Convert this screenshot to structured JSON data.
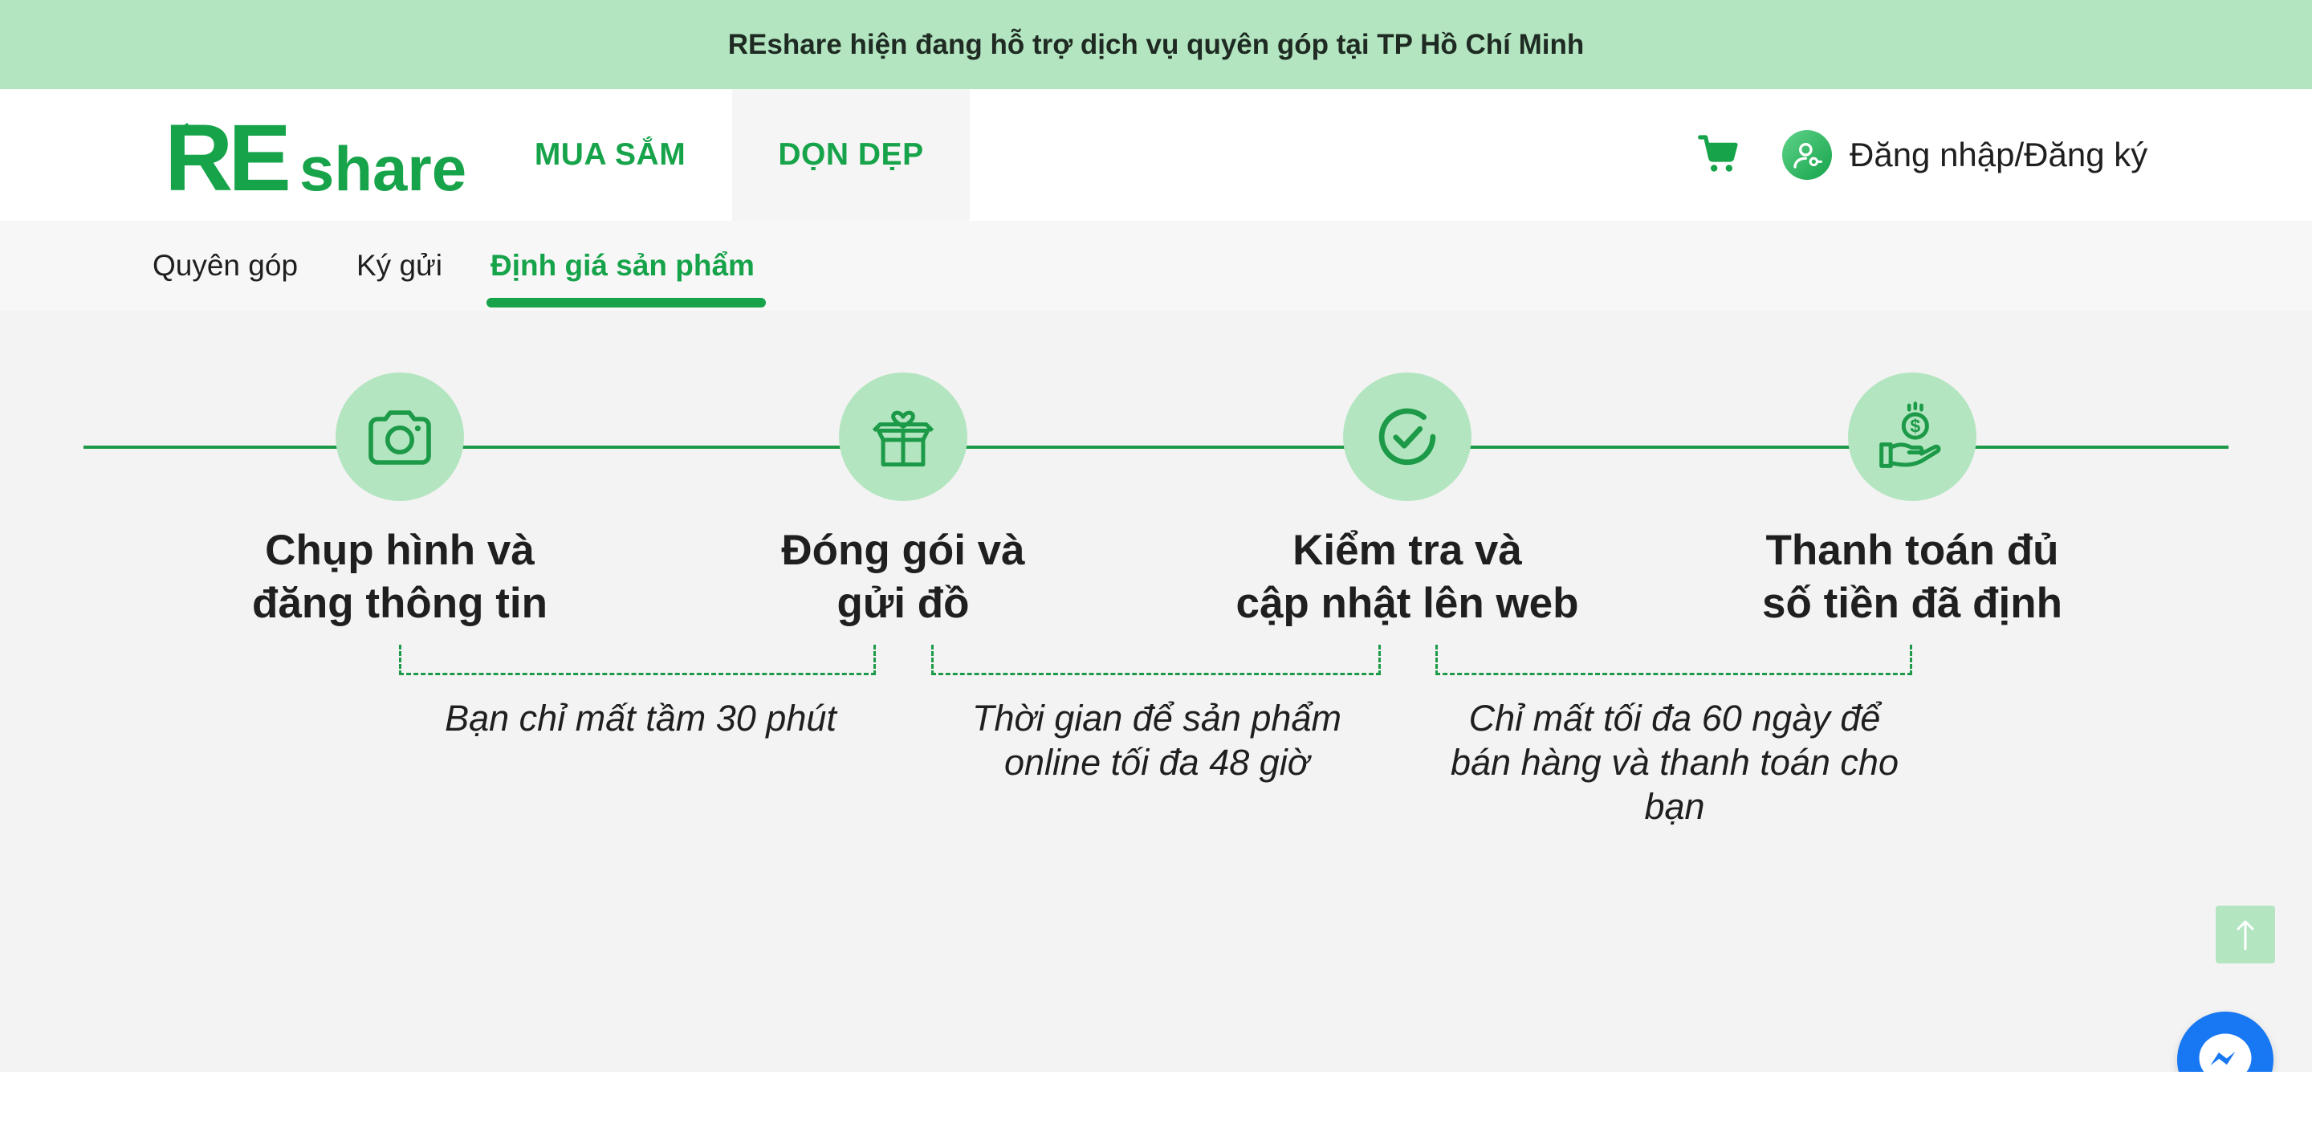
{
  "banner": {
    "text": "REshare hiện đang hỗ trợ dịch vụ quyên góp tại TP Hồ Chí Minh"
  },
  "header": {
    "logo": {
      "text_re": "RE",
      "text_share": "share"
    },
    "nav": [
      {
        "label": "MUA SẮM"
      },
      {
        "label": "DỌN DẸP"
      }
    ],
    "cart_icon": "cart-icon",
    "login_label": "Đăng nhập/Đăng ký"
  },
  "subnav": {
    "items": [
      {
        "label": "Quyên góp"
      },
      {
        "label": "Ký gửi"
      },
      {
        "label": "Định giá sản phẩm",
        "active": true
      }
    ]
  },
  "steps": [
    {
      "icon": "camera-icon",
      "title": "Chụp hình và\nđăng thông tin"
    },
    {
      "icon": "gift-box-icon",
      "title": "Đóng gói và\ngửi đồ"
    },
    {
      "icon": "check-circle-icon",
      "title": "Kiểm tra và\ncập nhật lên web"
    },
    {
      "icon": "money-hand-icon",
      "title": "Thanh toán đủ\nsố tiền đã định"
    }
  ],
  "notes": [
    {
      "text": "Bạn chỉ mất tầm 30 phút"
    },
    {
      "text": "Thời gian để sản phẩm\nonline tối đa 48 giờ"
    },
    {
      "text": "Chỉ mất tối đa 60 ngày để\nbán hàng và thanh toán cho\nbạn"
    }
  ],
  "colors": {
    "brand_green": "#16a34a",
    "light_green": "#b3e5c0",
    "messenger_blue": "#1877f2"
  },
  "floating": {
    "scroll_top_icon": "arrow-up-icon",
    "messenger_icon": "messenger-icon"
  }
}
